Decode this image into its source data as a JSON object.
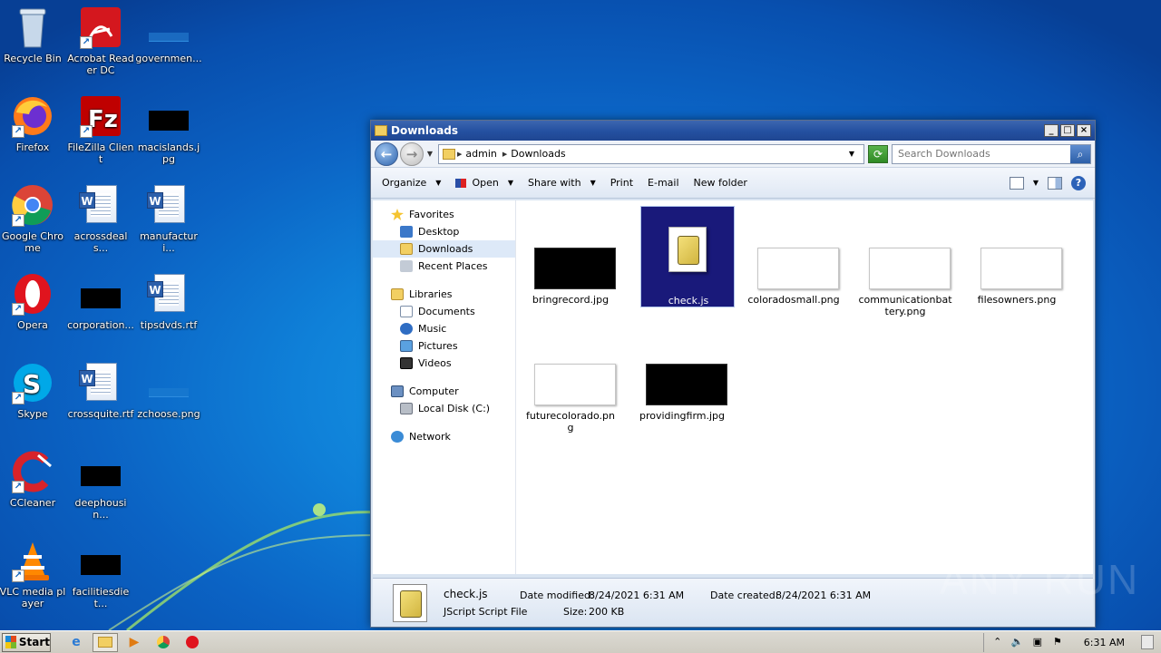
{
  "desktop": {
    "icons": [
      {
        "label": "Recycle Bin"
      },
      {
        "label": "Acrobat Reader DC"
      },
      {
        "label": "governmen..."
      },
      {
        "label": "Firefox"
      },
      {
        "label": "FileZilla Client"
      },
      {
        "label": "macislands.jpg"
      },
      {
        "label": "Google Chrome"
      },
      {
        "label": "acrossdeals..."
      },
      {
        "label": "manufacturi..."
      },
      {
        "label": "Opera"
      },
      {
        "label": "corporation..."
      },
      {
        "label": "tipsdvds.rtf"
      },
      {
        "label": "Skype"
      },
      {
        "label": "crossquite.rtf"
      },
      {
        "label": "zchoose.png"
      },
      {
        "label": "CCleaner"
      },
      {
        "label": "deephousin..."
      },
      {
        "label": "VLC media player"
      },
      {
        "label": "facilitiesdiet..."
      }
    ]
  },
  "window": {
    "title": "Downloads",
    "address": {
      "root": "admin",
      "current": "Downloads"
    },
    "search_placeholder": "Search Downloads",
    "toolbar": {
      "organize": "Organize",
      "open": "Open",
      "share_with": "Share with",
      "print": "Print",
      "email": "E-mail",
      "new_folder": "New folder"
    },
    "nav": {
      "favorites": "Favorites",
      "desktop": "Desktop",
      "downloads": "Downloads",
      "recent_places": "Recent Places",
      "libraries": "Libraries",
      "documents": "Documents",
      "music": "Music",
      "pictures": "Pictures",
      "videos": "Videos",
      "computer": "Computer",
      "local_disk": "Local Disk (C:)",
      "network": "Network"
    },
    "files": [
      {
        "name": "bringrecord.jpg"
      },
      {
        "name": "check.js",
        "selected": true
      },
      {
        "name": "coloradosmall.png"
      },
      {
        "name": "communicationbattery.png"
      },
      {
        "name": "filesowners.png"
      },
      {
        "name": "futurecolorado.png"
      },
      {
        "name": "providingfirm.jpg"
      }
    ],
    "details": {
      "name": "check.js",
      "type": "JScript Script File",
      "modified_label": "Date modified:",
      "modified": "8/24/2021 6:31 AM",
      "created_label": "Date created:",
      "created": "8/24/2021 6:31 AM",
      "size_label": "Size:",
      "size": "200 KB"
    }
  },
  "taskbar": {
    "start": "Start",
    "clock": "6:31 AM"
  },
  "watermark": "ANY RUN"
}
